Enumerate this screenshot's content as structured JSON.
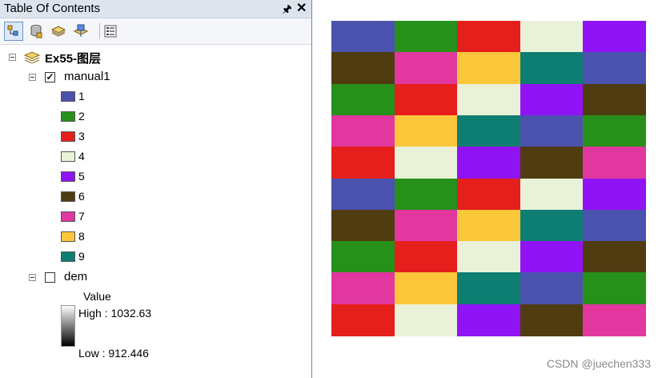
{
  "window": {
    "title": "Table Of Contents",
    "pin_glyph": "⨇",
    "close_glyph": "✕"
  },
  "toolbar": {
    "buttons": [
      "list-by-drawing-order-icon",
      "list-by-source-icon",
      "list-by-visibility-icon",
      "list-by-selection-icon",
      "options-icon"
    ]
  },
  "tree": {
    "dataframe": {
      "name": "Ex55-图层"
    },
    "layers": [
      {
        "name": "manual1",
        "checked": true,
        "classes": [
          {
            "label": "1",
            "color": "#4a52ae"
          },
          {
            "label": "2",
            "color": "#27901a"
          },
          {
            "label": "3",
            "color": "#e51f1c"
          },
          {
            "label": "4",
            "color": "#e9f1d8"
          },
          {
            "label": "5",
            "color": "#9013f5"
          },
          {
            "label": "6",
            "color": "#4f3c10"
          },
          {
            "label": "7",
            "color": "#e2379e"
          },
          {
            "label": "8",
            "color": "#fcc73a"
          },
          {
            "label": "9",
            "color": "#0f7e72"
          }
        ]
      },
      {
        "name": "dem",
        "checked": false,
        "legend": {
          "title": "Value",
          "high": "High : 1032.63",
          "low": "Low : 912.446"
        }
      }
    ]
  },
  "map": {
    "grid": [
      [
        1,
        2,
        3,
        4,
        5
      ],
      [
        6,
        7,
        8,
        9,
        1
      ],
      [
        2,
        3,
        4,
        5,
        6
      ],
      [
        7,
        8,
        9,
        1,
        2
      ],
      [
        3,
        4,
        5,
        6,
        7
      ],
      [
        1,
        2,
        3,
        4,
        5
      ],
      [
        6,
        7,
        8,
        9,
        1
      ],
      [
        2,
        3,
        4,
        5,
        6
      ],
      [
        7,
        8,
        9,
        1,
        2
      ],
      [
        3,
        4,
        5,
        6,
        7
      ]
    ],
    "watermark": "CSDN @juechen333"
  }
}
